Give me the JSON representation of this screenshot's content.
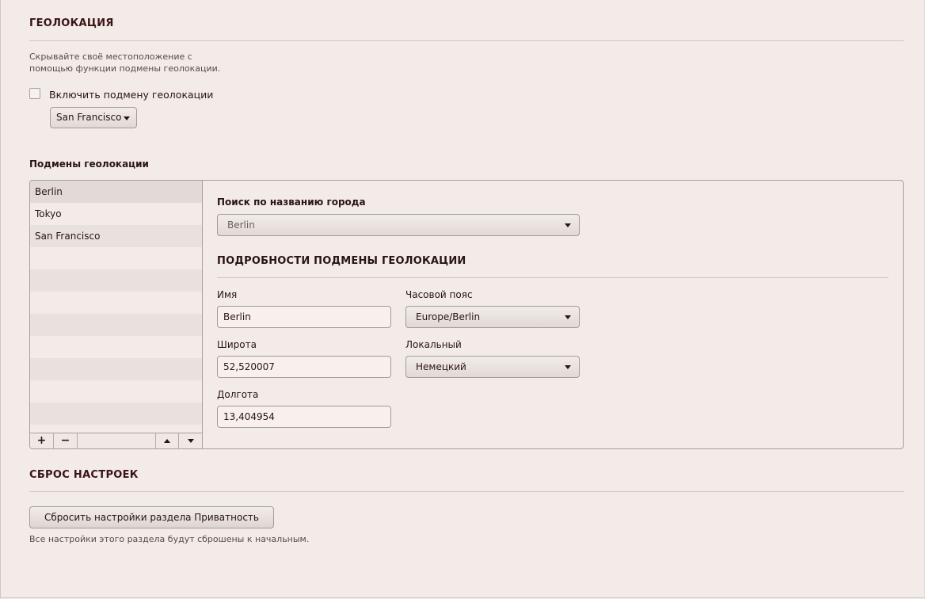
{
  "geolocation": {
    "title": "ГЕОЛОКАЦИЯ",
    "description_line1": "Скрывайте своё местоположение с",
    "description_line2": "помощью функции подмены геолокации.",
    "enable_label": "Включить подмену геолокации",
    "enabled": false,
    "preset_value": "San Francisco"
  },
  "overrides": {
    "title": "Подмены геолокации",
    "items": [
      "Berlin",
      "Tokyo",
      "San Francisco"
    ],
    "selected_index": 0,
    "toolbar": {
      "add": "+",
      "remove": "−"
    }
  },
  "detail": {
    "search_label": "Поиск по названию города",
    "search_value": "Berlin",
    "section_title": "ПОДРОБНОСТИ ПОДМЕНЫ ГЕОЛОКАЦИИ",
    "name_label": "Имя",
    "name_value": "Berlin",
    "timezone_label": "Часовой пояс",
    "timezone_value": "Europe/Berlin",
    "latitude_label": "Широта",
    "latitude_value": "52,520007",
    "locale_label": "Локальный",
    "locale_value": "Немецкий",
    "longitude_label": "Долгота",
    "longitude_value": "13,404954"
  },
  "reset": {
    "title": "СБРОС НАСТРОЕК",
    "button_label": "Сбросить настройки раздела Приватность",
    "note": "Все настройки этого раздела будут сброшены к начальным."
  },
  "icons": [
    "checkbox-icon",
    "dropdown-caret-icon",
    "add-icon",
    "remove-icon",
    "move-up-icon",
    "move-down-icon"
  ]
}
